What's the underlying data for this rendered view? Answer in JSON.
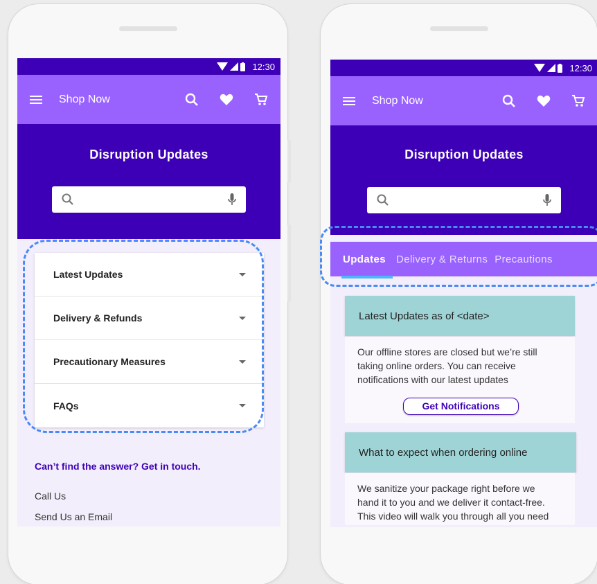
{
  "status": {
    "time": "12:30"
  },
  "appbar": {
    "title": "Shop Now",
    "icons": [
      "menu-icon",
      "search-icon",
      "heart-icon",
      "cart-icon"
    ]
  },
  "hero": {
    "title": "Disruption Updates",
    "search_icons": [
      "search-icon",
      "mic-icon"
    ]
  },
  "left": {
    "accordion": [
      "Latest Updates",
      "Delivery & Refunds",
      "Precautionary Measures",
      "FAQs"
    ],
    "contact": {
      "question": "Can’t find the answer? Get in touch.",
      "call": "Call Us",
      "email": "Send Us an Email"
    }
  },
  "right": {
    "tabs": [
      "Updates",
      "Delivery & Returns",
      "Precautions"
    ],
    "card1": {
      "title": "Latest Updates as of <date>",
      "line1": "Our offline stores are closed but we’re still",
      "line2": "taking online orders. You can receive",
      "line3": "notifications with our latest updates",
      "button": "Get Notifications"
    },
    "card2": {
      "title": "What to expect when ordering online",
      "line1": "We sanitize your package right before we",
      "line2": "hand it to you and we deliver it contact-free.",
      "line3": "This video will walk you through all you need"
    }
  },
  "colors": {
    "primary_dark": "#3d00b7",
    "primary": "#9962ff",
    "teal": "#9fd4d6",
    "highlight": "#4a8af4"
  }
}
